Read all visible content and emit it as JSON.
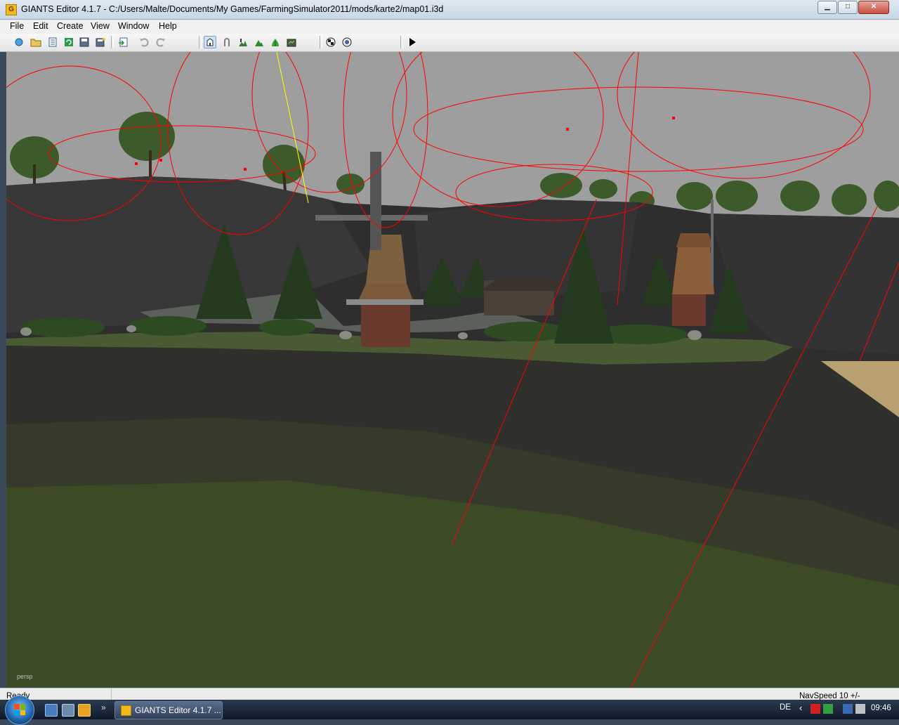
{
  "window": {
    "title": "GIANTS Editor 4.1.7 - C:/Users/Malte/Documents/My Games/FarmingSimulator2011/mods/karte2/map01.i3d",
    "icon_letter": "G",
    "minimize": "▁",
    "maximize": "□",
    "close": "✕"
  },
  "menu": {
    "items": [
      "File",
      "Edit",
      "Create",
      "View",
      "Window",
      "Help"
    ]
  },
  "toolbar": {
    "icons": [
      "new-scene-icon",
      "open-icon",
      "list-icon",
      "reload-icon",
      "save-icon",
      "save-as-icon",
      "import-icon",
      "undo-icon",
      "redo-icon",
      "select-mode-icon",
      "move-mode-icon",
      "terrain-sculpt-icon",
      "terrain-paint-icon",
      "foliage-paint-icon",
      "terrain-export-icon",
      "render-options-icon",
      "camera-options-icon",
      "play-icon"
    ]
  },
  "viewport": {
    "camera_label": "persp",
    "colors": {
      "sky": "#9e9e9e",
      "grass": "#3c4a26",
      "cliff": "#303030",
      "spline": "#ff0000",
      "highlight_spline": "#ffff00"
    }
  },
  "status": {
    "left": "Ready",
    "right": "NavSpeed 10 +/-"
  },
  "taskbar": {
    "task_label": "GIANTS Editor 4.1.7 ...",
    "language": "DE",
    "clock": "09:46",
    "quicklaunch": [
      "show-desktop-icon",
      "switch-windows-icon",
      "media-player-icon"
    ],
    "chevron": "»"
  }
}
